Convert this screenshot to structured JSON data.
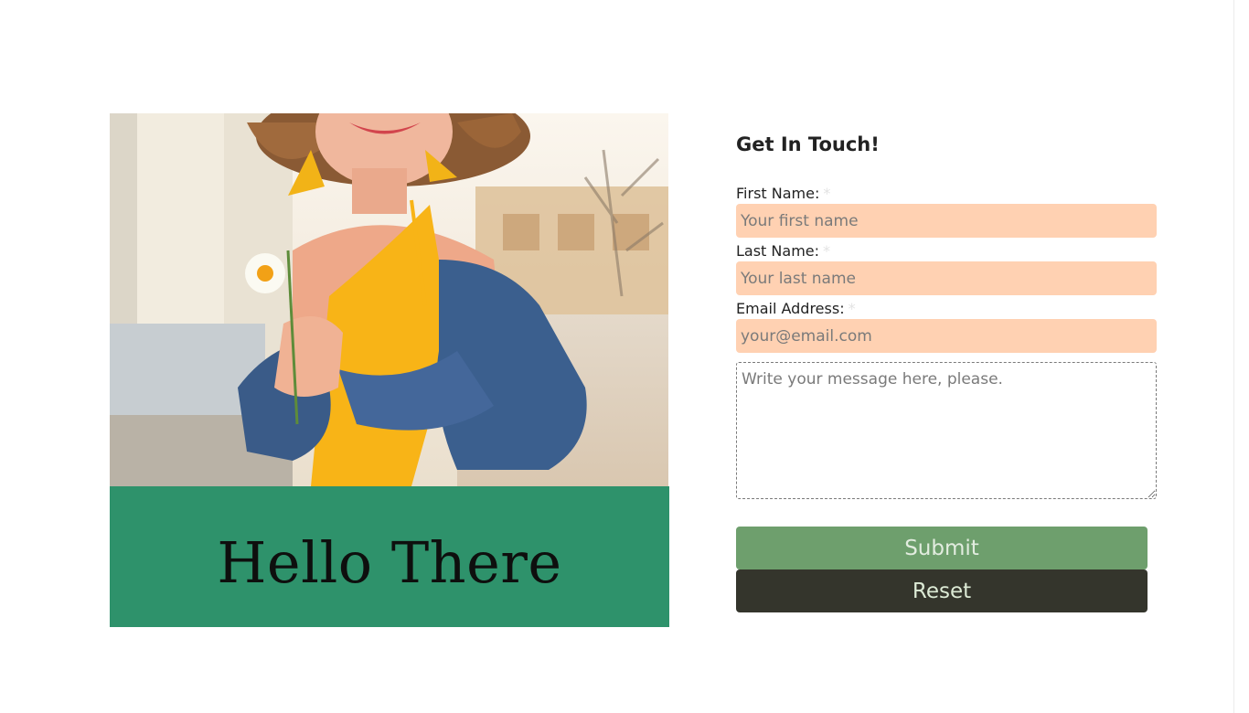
{
  "hero": {
    "banner_text": "Hello There"
  },
  "form": {
    "title": "Get In Touch!",
    "required_mark": "*",
    "fields": [
      {
        "label": "First Name:",
        "placeholder": "Your first name",
        "value": ""
      },
      {
        "label": "Last Name:",
        "placeholder": "Your last name",
        "value": ""
      },
      {
        "label": "Email Address:",
        "placeholder": "your@email.com",
        "value": ""
      }
    ],
    "message": {
      "placeholder": "Write your message here, please.",
      "value": ""
    },
    "submit_label": "Submit",
    "reset_label": "Reset"
  },
  "colors": {
    "banner_green": "#2e926b",
    "input_bg": "#ffd1b2",
    "submit_bg": "#6e9f6d",
    "reset_bg": "#34352c"
  }
}
